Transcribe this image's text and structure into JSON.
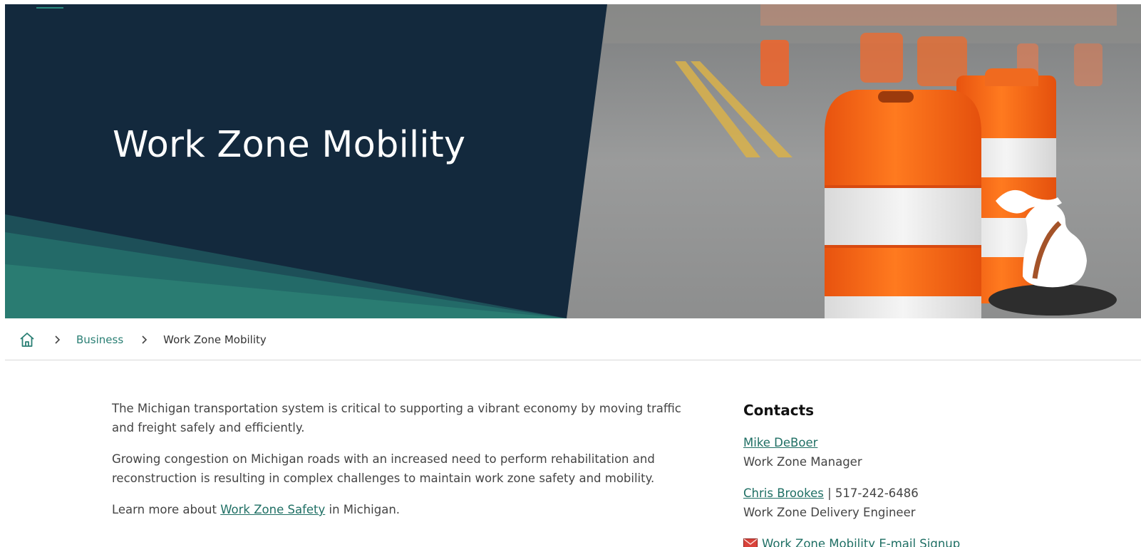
{
  "hero": {
    "title": "Work Zone Mobility"
  },
  "breadcrumb": {
    "home_icon": "home-icon",
    "separator_icon": "chevron-right-icon",
    "items": [
      {
        "label": "Business",
        "link": true
      },
      {
        "label": "Work Zone Mobility",
        "link": false
      }
    ]
  },
  "main": {
    "paragraph1": "The Michigan transportation system is critical to supporting a vibrant economy by moving traffic and freight safely and efficiently.",
    "paragraph2": "Growing congestion on Michigan roads with an increased need to perform rehabilitation and reconstruction is resulting in complex challenges to maintain work zone safety and mobility.",
    "paragraph3_before": "Learn more about ",
    "paragraph3_link": "Work Zone Safety",
    "paragraph3_after": " in Michigan."
  },
  "contacts": {
    "heading": "Contacts",
    "people": [
      {
        "name": "Mike DeBoer",
        "phone": "",
        "title": "Work Zone Manager"
      },
      {
        "name": "Chris Brookes",
        "phone": " | 517-242-6486",
        "title": "Work Zone Delivery Engineer"
      }
    ],
    "signup_label": "Work Zone Mobility E-mail Signup",
    "signup_icon": "envelope-icon"
  },
  "colors": {
    "navy": "#13293d",
    "teal": "#2a7f74",
    "link": "#1f6f64",
    "cone_orange": "#ff6a13"
  }
}
